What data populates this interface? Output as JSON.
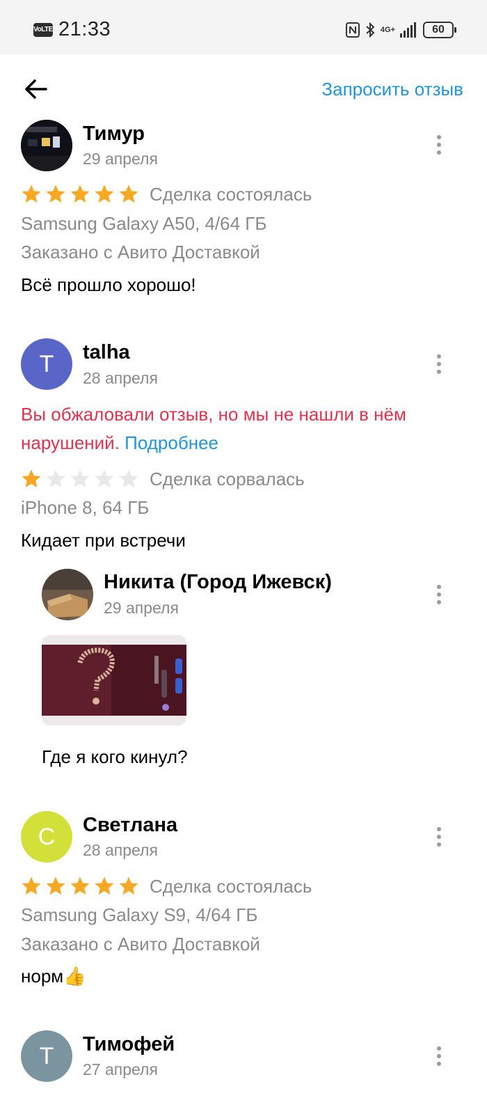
{
  "status_bar": {
    "volte": "VoLTE",
    "time": "21:33",
    "network": "4G+",
    "battery": "60"
  },
  "header": {
    "request_review": "Запросить отзыв"
  },
  "reviews": [
    {
      "name": "Тимур",
      "date": "29 апреля",
      "rating": 5,
      "status": "Сделка состоялась",
      "item": "Samsung Galaxy A50, 4/64 ГБ",
      "delivery": "Заказано с Авито Доставкой",
      "text": "Всё прошло хорошо!"
    },
    {
      "name": "talha",
      "date": "28 апреля",
      "avatar_letter": "T",
      "avatar_color": "#5a66c7",
      "appeal_notice": "Вы обжаловали отзыв, но мы не нашли в нём нарушений.",
      "appeal_link": "Подробнее",
      "rating": 1,
      "status": "Сделка сорвалась",
      "item": "iPhone 8, 64 ГБ",
      "text": "Кидает при встречи",
      "reply": {
        "name": "Никита (Город Ижевск)",
        "date": "29 апреля",
        "text": "Где я кого кинул?"
      }
    },
    {
      "name": "Светлана",
      "date": "28 апреля",
      "avatar_letter": "С",
      "avatar_color": "#d4e03a",
      "rating": 5,
      "status": "Сделка состоялась",
      "item": "Samsung Galaxy S9, 4/64 ГБ",
      "delivery": "Заказано с Авито Доставкой",
      "text": "норм👍"
    },
    {
      "name": "Тимофей",
      "date": "27 апреля",
      "avatar_letter": "T",
      "avatar_color": "#7b95a0"
    }
  ],
  "colors": {
    "accent": "#1f95e0",
    "star_filled": "#f7a823",
    "star_empty": "#e8e8e8",
    "warning": "#e2324d"
  }
}
